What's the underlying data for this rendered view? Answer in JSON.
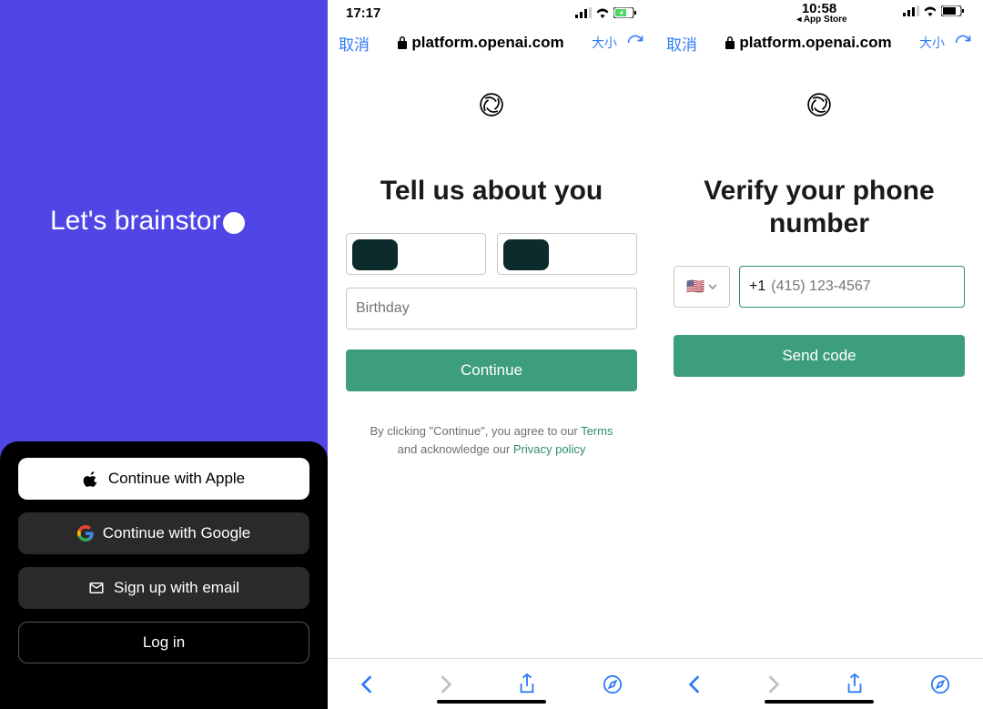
{
  "pane1": {
    "brainstorm_text": "Let's brainstor",
    "buttons": {
      "apple": "Continue with Apple",
      "google": "Continue with Google",
      "email": "Sign up with email",
      "login": "Log in"
    }
  },
  "pane2": {
    "status_time": "17:17",
    "cancel": "取消",
    "url": "platform.openai.com",
    "size_label": "大小",
    "heading": "Tell us about you",
    "birthday_placeholder": "Birthday",
    "continue_label": "Continue",
    "disclaimer_prefix": "By clicking \"Continue\", you agree to our ",
    "terms_label": "Terms",
    "disclaimer_mid": " and acknowledge our ",
    "privacy_label": "Privacy policy"
  },
  "pane3": {
    "status_time": "10:58",
    "appstore_back": "◂ App Store",
    "cancel": "取消",
    "url": "platform.openai.com",
    "size_label": "大小",
    "heading": "Verify your phone number",
    "country_flag": "🇺🇸",
    "phone_prefix": "+1",
    "phone_placeholder": "(415) 123-4567",
    "send_code_label": "Send code"
  }
}
